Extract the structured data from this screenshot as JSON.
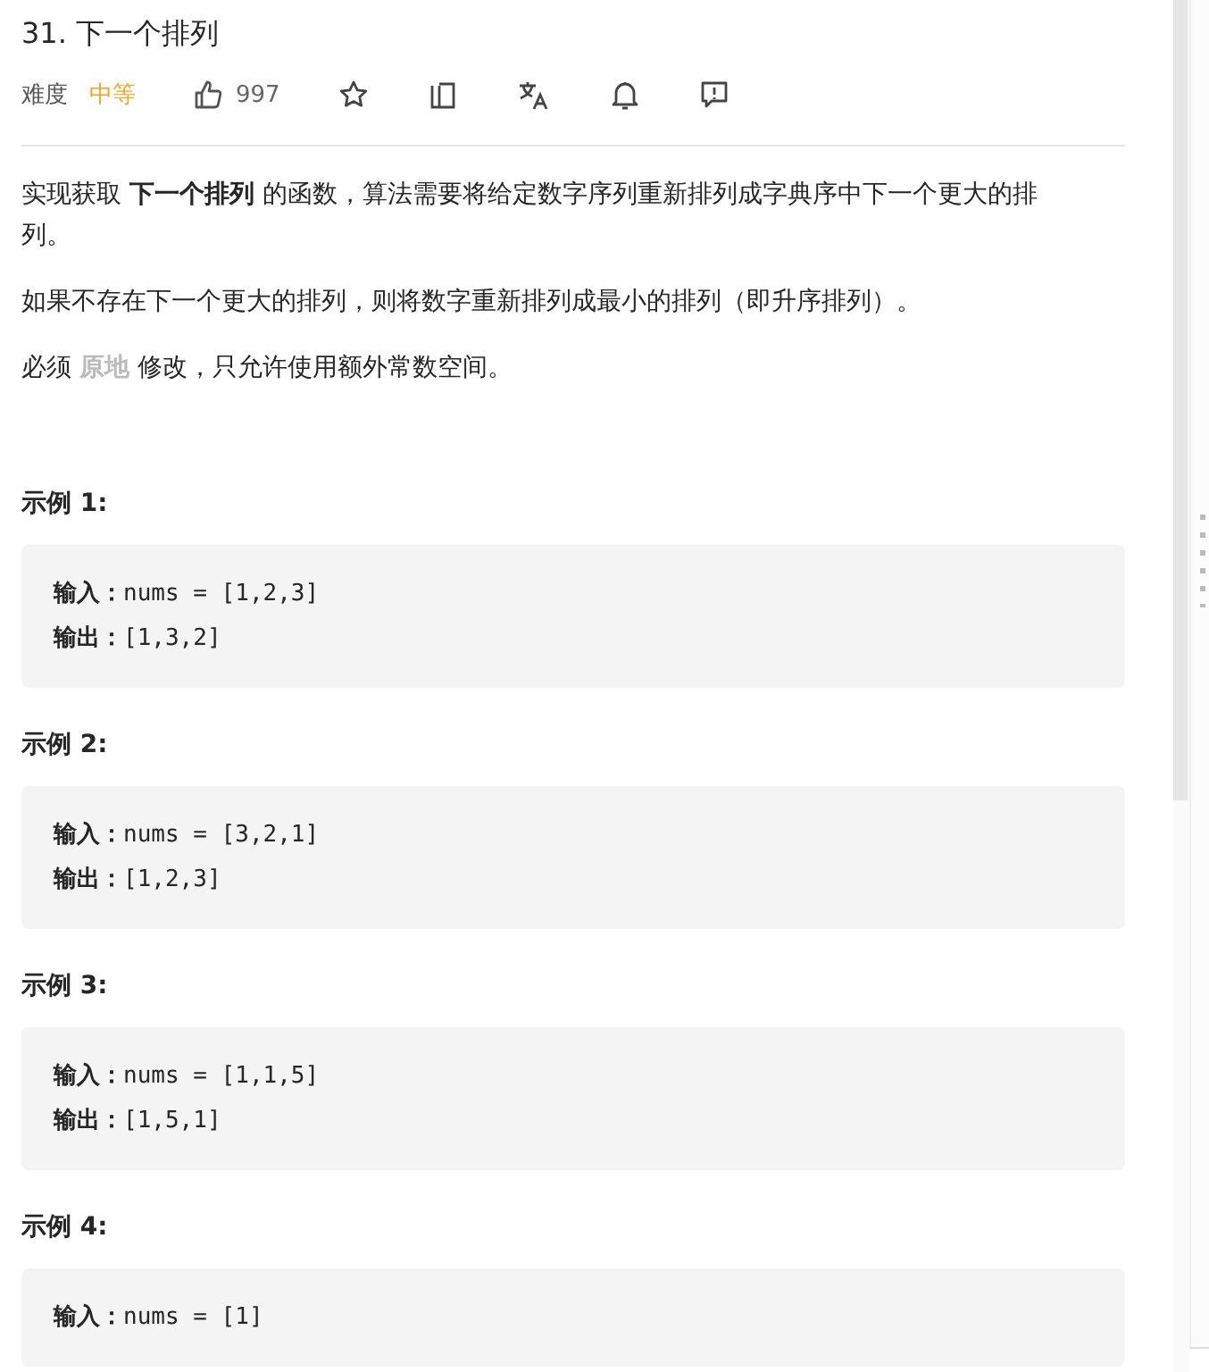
{
  "title": "31. 下一个排列",
  "meta": {
    "difficulty_label": "难度",
    "difficulty": "中等",
    "likes": "997"
  },
  "paragraphs": [
    {
      "text": "实现获取 **下一个排列** 的函数，算法需要将给定数字序列重新排列成字典序中下一个更大的排列。",
      "kind": "text"
    },
    {
      "text": "如果不存在下一个更大的排列，则将数字重新排列成最小的排列（即升序排列）。",
      "kind": "text"
    },
    {
      "text": "必须 **原地** 修改，只允许使用额外常数空间。",
      "kind": "note"
    }
  ],
  "examples": [
    {
      "title": "示例 1:",
      "lines": [
        "**输入：**nums = [1,2,3]",
        "**输出：**[1,3,2]"
      ]
    },
    {
      "title": "示例 2:",
      "lines": [
        "**输入：**nums = [3,2,1]",
        "**输出：**[1,2,3]"
      ]
    },
    {
      "title": "示例 3:",
      "lines": [
        "**输入：**nums = [1,1,5]",
        "**输出：**[1,5,1]"
      ]
    },
    {
      "title": "示例 4:",
      "lines": [
        "**输入：**nums = [1]"
      ]
    }
  ]
}
